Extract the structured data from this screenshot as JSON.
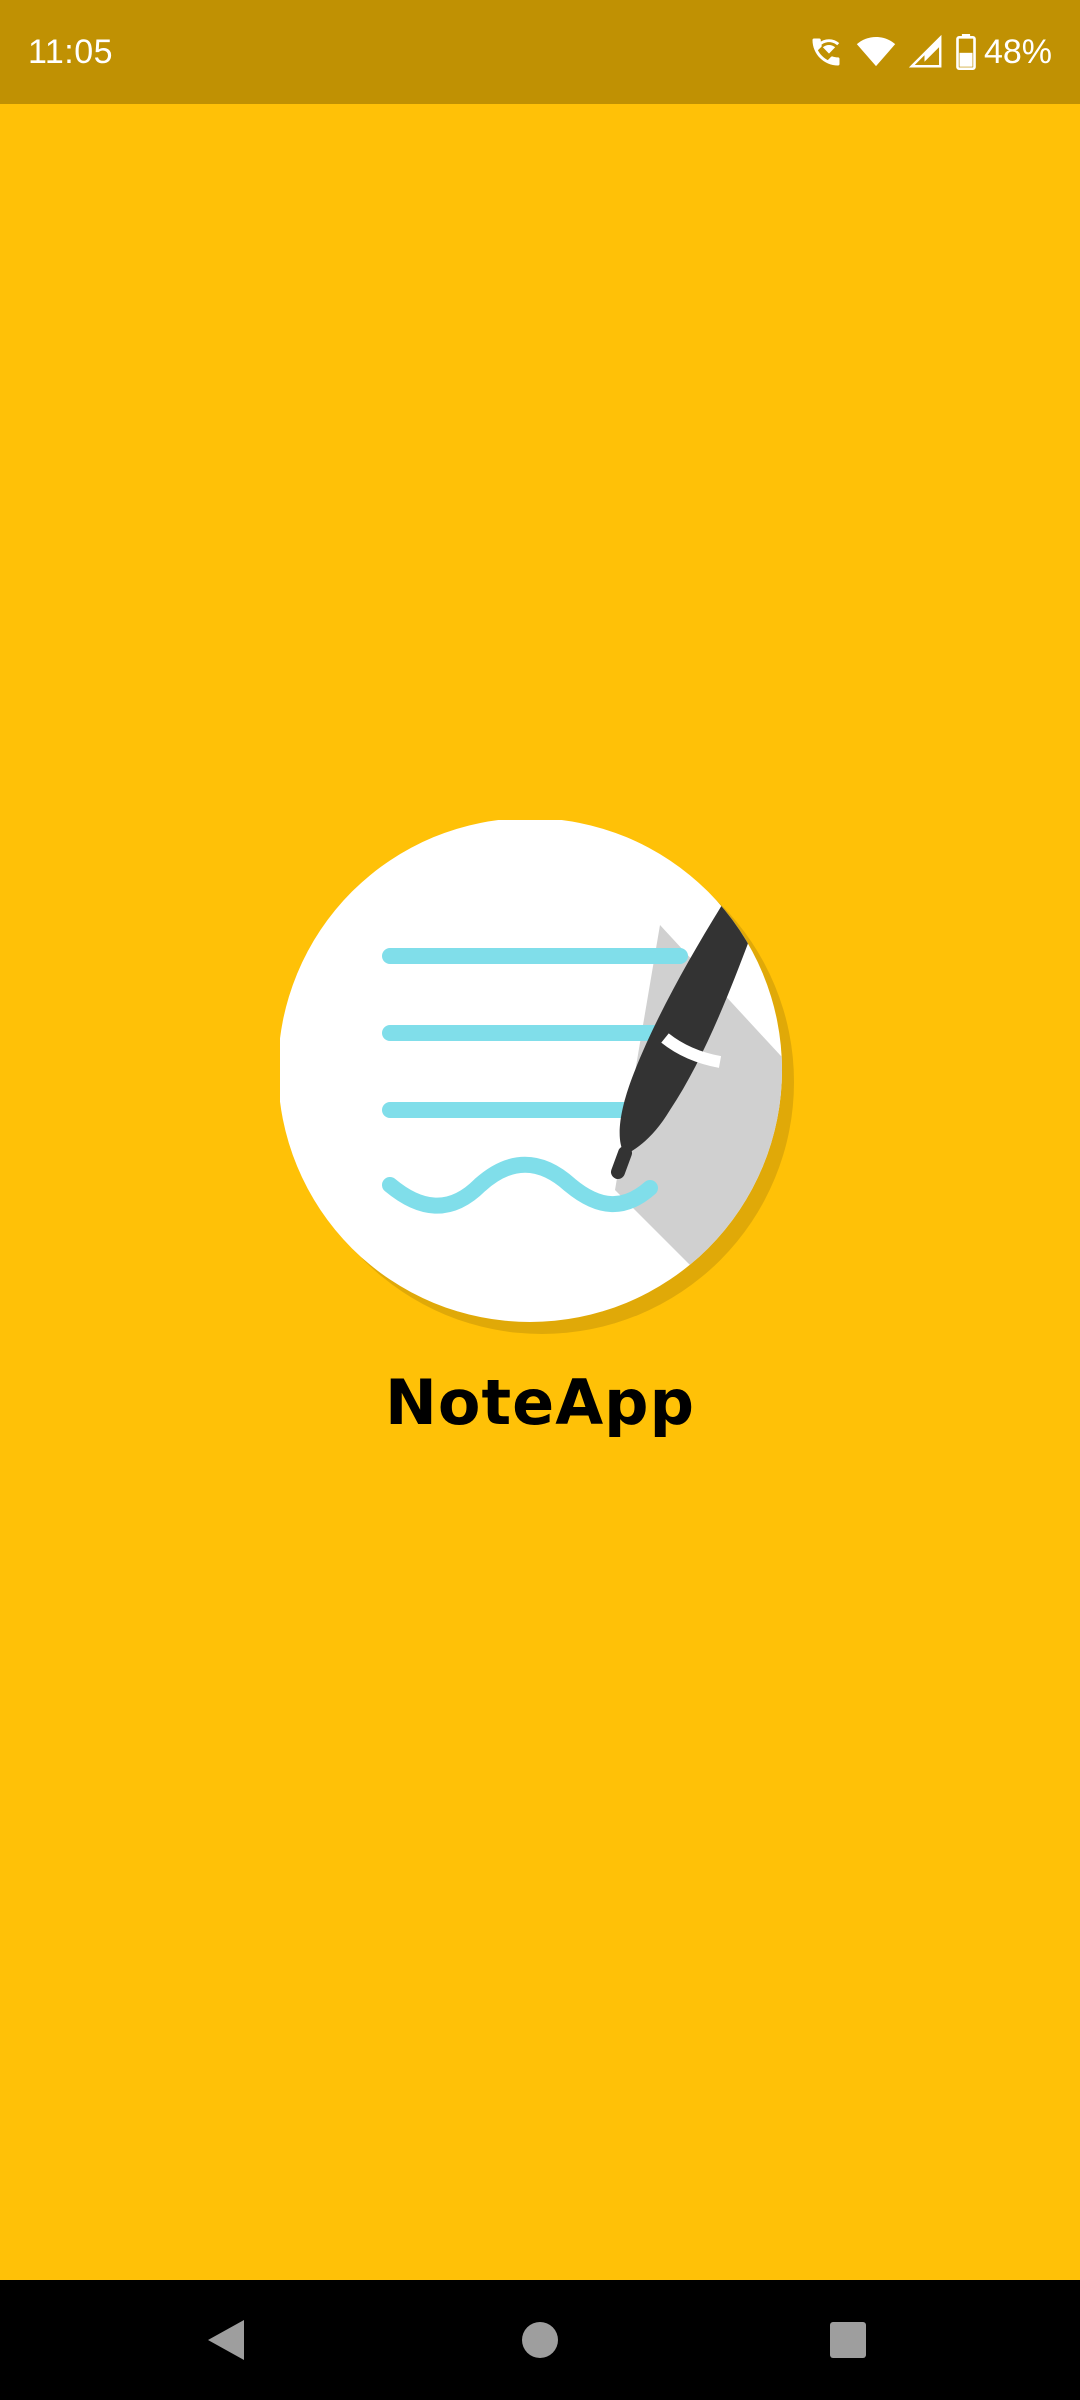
{
  "status_bar": {
    "time": "11:05",
    "icons": [
      "wifi-calling-icon",
      "wifi-icon",
      "cell-signal-icon",
      "battery-icon"
    ],
    "battery_percent": "48%"
  },
  "splash": {
    "app_name": "NoteApp",
    "logo_icon": "note-pen-logo-icon",
    "colors": {
      "background": "#FFC107",
      "status_bar": "#C09103",
      "note_lines": "#80DEEA",
      "pen": "#333333",
      "pen_shadow": "#D0D0D0",
      "circle": "#FFFFFF"
    }
  },
  "nav_bar": {
    "buttons": [
      "back-button",
      "home-button",
      "recents-button"
    ]
  }
}
